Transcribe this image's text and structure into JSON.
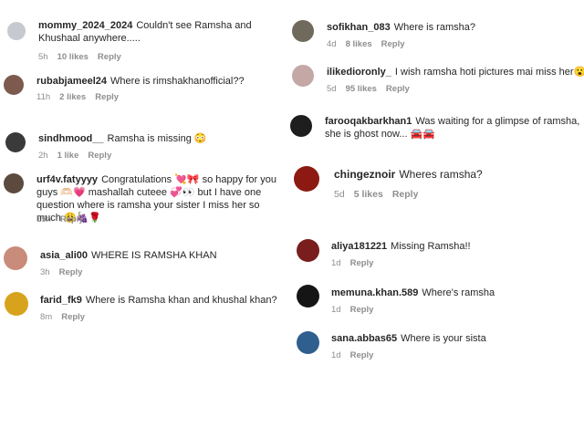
{
  "comments": [
    {
      "user": "mommy_2024_2024",
      "text": "Couldn't see Ramsha and Khushaal anywhere.....",
      "time": "5h",
      "likes": "10 likes",
      "reply": "Reply",
      "avatar_color": "#c7c9d1"
    },
    {
      "user": "rubabjameel24",
      "text": "Where is rimshakhanofficial??",
      "time": "11h",
      "likes": "2 likes",
      "reply": "Reply",
      "avatar_color": "#7d5a4e"
    },
    {
      "user": "sindhmood__",
      "text": "Ramsha is missing 😳",
      "time": "2h",
      "likes": "1 like",
      "reply": "Reply",
      "avatar_color": "#3a3a3a"
    },
    {
      "user": "urf4v.fatyyyy",
      "text": "Congratulations 💘🎀 so happy for you guys 🫶🏻💗 mashallah cuteee 💞👀 but I have one question where is ramsha your sister I miss her so much 😩🍇🌹",
      "time": "15h",
      "likes": "",
      "reply": "Reply",
      "avatar_color": "#5c4a3f"
    },
    {
      "user": "asia_ali00",
      "text": "WHERE IS RAMSHA KHAN",
      "time": "3h",
      "likes": "",
      "reply": "Reply",
      "avatar_color": "#c98b7a"
    },
    {
      "user": "farid_fk9",
      "text": "Where is Ramsha khan and khushal khan?",
      "time": "8m",
      "likes": "",
      "reply": "Reply",
      "avatar_color": "#d8a31c"
    },
    {
      "user": "sofikhan_083",
      "text": "Where is ramsha?",
      "time": "4d",
      "likes": "8 likes",
      "reply": "Reply",
      "avatar_color": "#6f6a5c"
    },
    {
      "user": "ilikedioronly_",
      "text": "I wish ramsha hoti pictures mai miss her😮",
      "time": "5d",
      "likes": "95 likes",
      "reply": "Reply",
      "avatar_color": "#c4a8a6"
    },
    {
      "user": "farooqakbarkhan1",
      "text": "Was waiting for a glimpse of ramsha, she is ghost now... 🚘🚘",
      "time": "",
      "likes": "",
      "reply": "",
      "avatar_color": "#1e1e1e"
    },
    {
      "user": "chingeznoir",
      "text": "Wheres ramsha?",
      "time": "5d",
      "likes": "5 likes",
      "reply": "Reply",
      "avatar_color": "#8c1a12"
    },
    {
      "user": "aliya181221",
      "text": "Missing Ramsha!!",
      "time": "1d",
      "likes": "",
      "reply": "Reply",
      "avatar_color": "#7a1d1d"
    },
    {
      "user": "memuna.khan.589",
      "text": "Where's ramsha",
      "time": "1d",
      "likes": "",
      "reply": "Reply",
      "avatar_color": "#151515"
    },
    {
      "user": "sana.abbas65",
      "text": "Where is your sista",
      "time": "1d",
      "likes": "",
      "reply": "Reply",
      "avatar_color": "#2f5f8f"
    }
  ]
}
